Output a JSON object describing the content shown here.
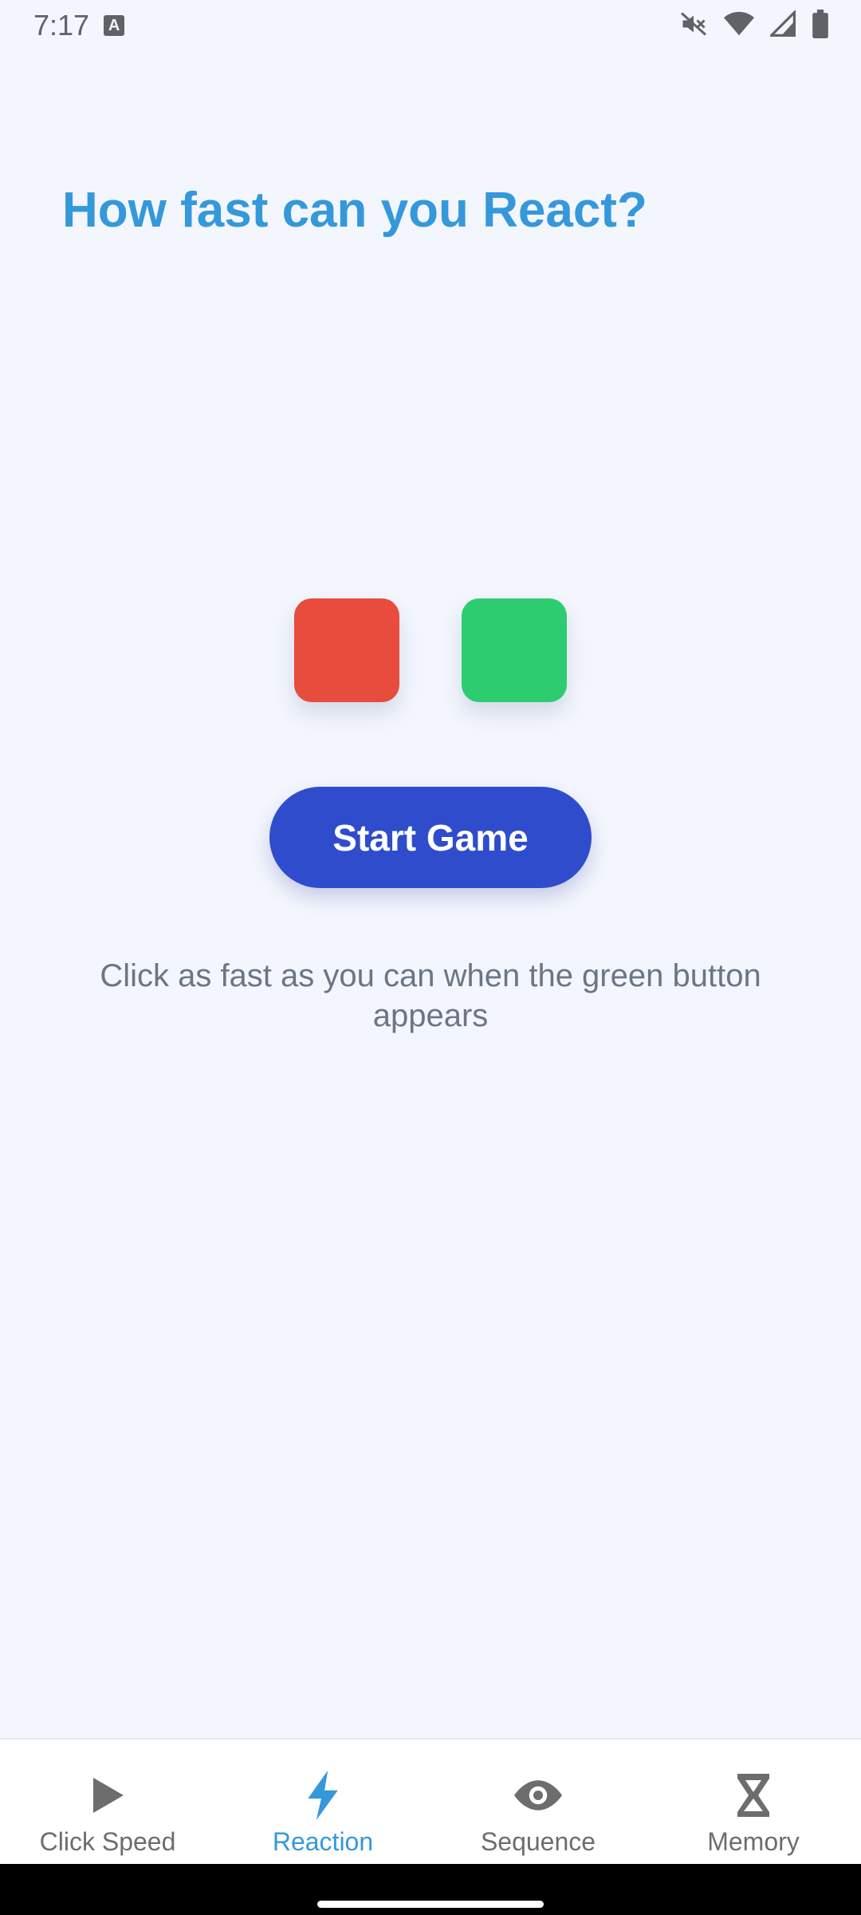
{
  "status_bar": {
    "time": "7:17",
    "keyboard_icon_letter": "A",
    "icons": [
      "mute-icon",
      "wifi-icon",
      "signal-icon",
      "battery-icon"
    ]
  },
  "main": {
    "title": "How fast can you React?",
    "squares": [
      {
        "name": "red",
        "color": "#e74c3c"
      },
      {
        "name": "green",
        "color": "#2ecc71"
      }
    ],
    "start_button_label": "Start Game",
    "hint": "Click as fast as you can when the green button appears"
  },
  "bottom_nav": {
    "items": [
      {
        "label": "Click Speed",
        "icon": "play-icon",
        "active": false
      },
      {
        "label": "Reaction",
        "icon": "lightning-icon",
        "active": true
      },
      {
        "label": "Sequence",
        "icon": "eye-icon",
        "active": false
      },
      {
        "label": "Memory",
        "icon": "hourglass-icon",
        "active": false
      }
    ]
  },
  "colors": {
    "background": "#f3f6fd",
    "accent": "#3498db",
    "button": "#2f4ccc",
    "inactive_nav": "#6d6d6d"
  }
}
